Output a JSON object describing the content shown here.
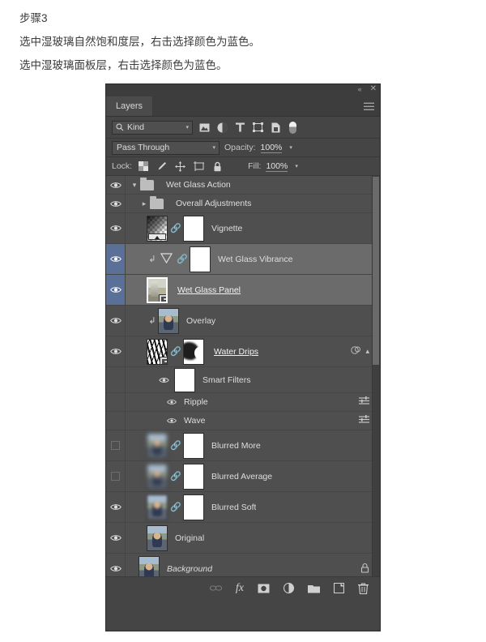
{
  "instructions": {
    "lines": [
      "步骤3",
      "选中湿玻璃自然饱和度层，右击选择颜色为蓝色。",
      "选中湿玻璃面板层，右击选择颜色为蓝色。"
    ]
  },
  "panel": {
    "titlebar": {
      "collapse_label": "«",
      "close_label": "✕"
    },
    "tab_label": "Layers",
    "menu_icon": "hamburger-menu-icon",
    "filter": {
      "kind_label": "Kind",
      "search_icon": "search-icon",
      "caret": "⌄",
      "icons": [
        "pixel-layer-filter-icon",
        "adjustment-layer-filter-icon",
        "type-layer-filter-icon",
        "shape-layer-filter-icon",
        "smart-object-filter-icon",
        "filter-enable-toggle"
      ]
    },
    "blend": {
      "mode": "Pass Through",
      "opacity_label": "Opacity:",
      "opacity_value": "100%"
    },
    "lock": {
      "label": "Lock:",
      "icons": [
        "lock-transparency-icon",
        "lock-image-icon",
        "lock-position-icon",
        "lock-artboard-icon",
        "lock-all-icon"
      ],
      "fill_label": "Fill:",
      "fill_value": "100%"
    },
    "layers": [
      {
        "name": "Wet Glass Action",
        "type": "group",
        "visible": true,
        "expanded": true,
        "indent": 0,
        "selected": false
      },
      {
        "name": "Overall Adjustments",
        "type": "group",
        "visible": true,
        "expanded": false,
        "indent": 1,
        "selected": false
      },
      {
        "name": "Vignette",
        "type": "gradient-fill",
        "visible": true,
        "indent": 1,
        "selected": false,
        "has_mask": true,
        "linked": true
      },
      {
        "name": "Wet Glass Vibrance",
        "type": "adjustment",
        "visible": true,
        "indent": 1,
        "selected": true,
        "clipped": true,
        "has_mask": true,
        "linked": true
      },
      {
        "name": "Wet Glass Panel",
        "type": "smart-object",
        "visible": true,
        "indent": 1,
        "selected": true,
        "editing": true
      },
      {
        "name": "Overlay",
        "type": "pixel",
        "visible": true,
        "indent": 1,
        "selected": false,
        "clipped": true
      },
      {
        "name": "Water Drips",
        "type": "smart-object",
        "visible": true,
        "indent": 1,
        "selected": false,
        "editing": true,
        "has_mask": true,
        "linked": true,
        "smart_filter_badge": true,
        "expanded": true
      },
      {
        "name": "Smart Filters",
        "type": "smart-filters",
        "visible": true,
        "indent": 2,
        "selected": false
      },
      {
        "name": "Ripple",
        "type": "smart-filter",
        "visible": true,
        "indent": 3,
        "selected": false
      },
      {
        "name": "Wave",
        "type": "smart-filter",
        "visible": true,
        "indent": 3,
        "selected": false
      },
      {
        "name": "Blurred More",
        "type": "pixel",
        "visible": false,
        "indent": 1,
        "selected": false,
        "has_mask": true,
        "linked": true
      },
      {
        "name": "Blurred Average",
        "type": "pixel",
        "visible": false,
        "indent": 1,
        "selected": false,
        "has_mask": true,
        "linked": true
      },
      {
        "name": "Blurred Soft",
        "type": "pixel",
        "visible": true,
        "indent": 1,
        "selected": false,
        "has_mask": true,
        "linked": true
      },
      {
        "name": "Original",
        "type": "pixel",
        "visible": true,
        "indent": 1,
        "selected": false
      },
      {
        "name": "Background",
        "type": "background",
        "visible": true,
        "indent": 0,
        "selected": false,
        "locked": true,
        "italic": true
      }
    ],
    "footer": {
      "buttons": [
        "link-layers-icon",
        "layer-style-fx-icon",
        "add-layer-mask-icon",
        "new-adjustment-layer-icon",
        "new-group-icon",
        "new-layer-icon",
        "delete-layer-icon"
      ],
      "fx_label": "fx"
    }
  },
  "colors": {
    "panel_bg": "#454545",
    "list_bg": "#4f4f4f",
    "selected_row": "#6b6b6b",
    "selected_eye": "#5a7099",
    "text": "#dedede"
  }
}
